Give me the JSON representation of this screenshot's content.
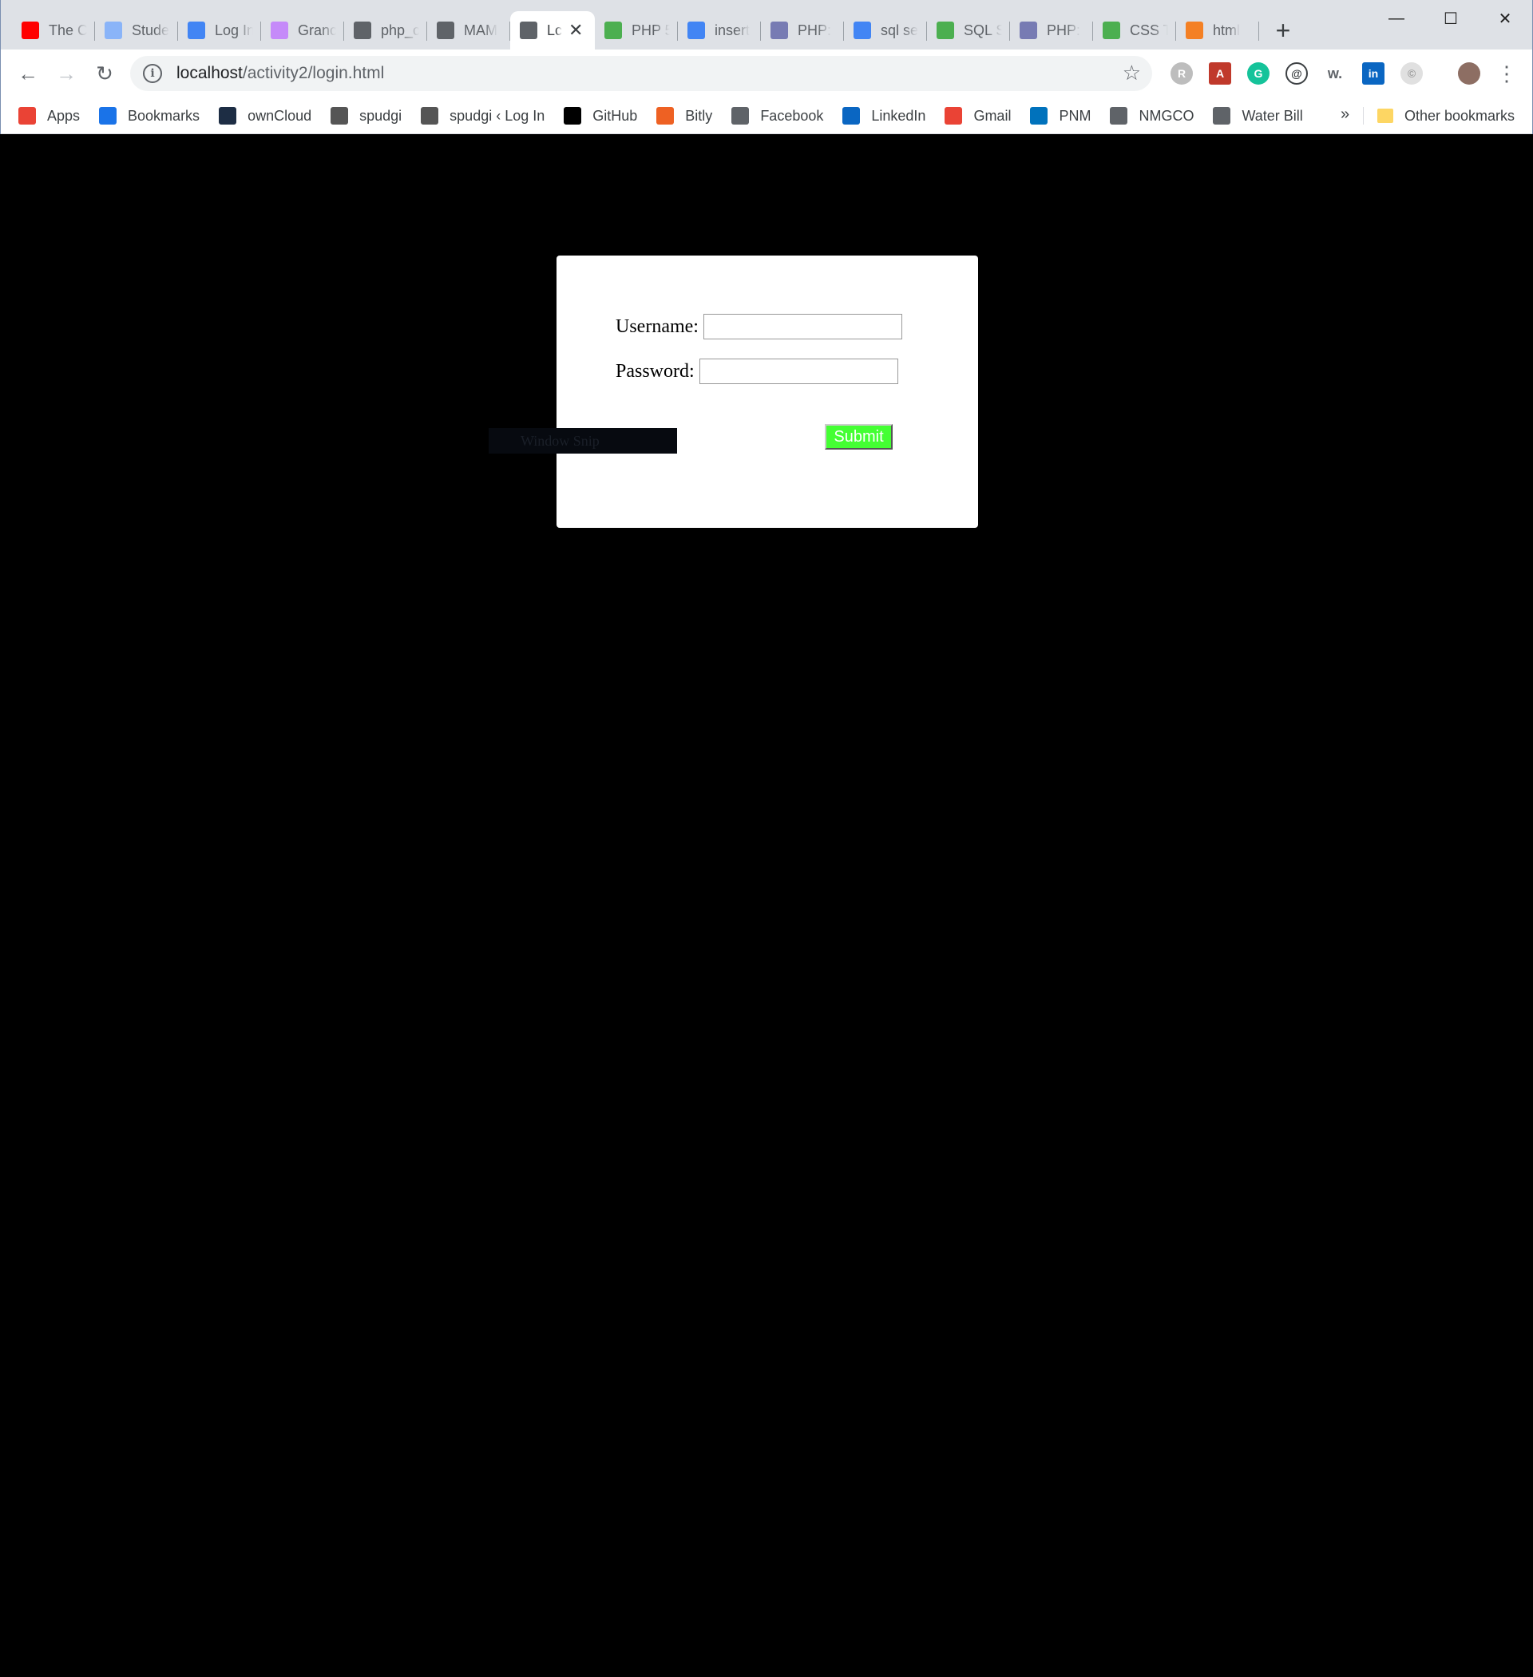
{
  "browser": {
    "tabs": [
      {
        "label": "The C",
        "icon": "youtube-icon",
        "color": "#ff0000"
      },
      {
        "label": "Stude",
        "icon": "page-icon",
        "color": "#8ab4f8"
      },
      {
        "label": "Log In",
        "icon": "globe-icon",
        "color": "#4285f4"
      },
      {
        "label": "Granc",
        "icon": "grid-icon",
        "color": "#c58af9"
      },
      {
        "label": "php_c",
        "icon": "file-icon",
        "color": "#5f6368"
      },
      {
        "label": "MAM",
        "icon": "file-icon",
        "color": "#5f6368"
      },
      {
        "label": "Lc",
        "icon": "file-icon",
        "color": "#5f6368",
        "active": true
      },
      {
        "label": "PHP 5",
        "icon": "w3schools-icon",
        "color": "#4caf50"
      },
      {
        "label": "insert",
        "icon": "google-icon",
        "color": "#4285f4"
      },
      {
        "label": "PHP: ",
        "icon": "php-icon",
        "color": "#777bb3"
      },
      {
        "label": "sql se",
        "icon": "google-icon",
        "color": "#4285f4"
      },
      {
        "label": "SQL S",
        "icon": "w3schools-icon",
        "color": "#4caf50"
      },
      {
        "label": "PHP: ",
        "icon": "php-icon",
        "color": "#777bb3"
      },
      {
        "label": "CSS T",
        "icon": "w3schools-icon",
        "color": "#4caf50"
      },
      {
        "label": "html",
        "icon": "stackoverflow-icon",
        "color": "#f48024"
      }
    ],
    "new_tab": "+",
    "window": {
      "minimize": "—",
      "maximize": "☐",
      "close": "✕"
    },
    "url": {
      "host": "localhost",
      "path": "/activity2/login.html"
    },
    "bookmarks": [
      {
        "label": "Apps",
        "icon": "apps-grid-icon",
        "color": "#ea4335"
      },
      {
        "label": "Bookmarks",
        "icon": "star-icon",
        "color": "#1a73e8"
      },
      {
        "label": "ownCloud",
        "icon": "owncloud-icon",
        "color": "#1d2d44"
      },
      {
        "label": "spudgi",
        "icon": "spudgi-icon",
        "color": "#555555"
      },
      {
        "label": "spudgi ‹ Log In",
        "icon": "spudgi-icon",
        "color": "#555555"
      },
      {
        "label": "GitHub",
        "icon": "github-icon",
        "color": "#000000"
      },
      {
        "label": "Bitly",
        "icon": "bitly-icon",
        "color": "#ee6123"
      },
      {
        "label": "Facebook",
        "icon": "file-icon",
        "color": "#5f6368"
      },
      {
        "label": "LinkedIn",
        "icon": "linkedin-icon",
        "color": "#0a66c2"
      },
      {
        "label": "Gmail",
        "icon": "gmail-icon",
        "color": "#ea4335"
      },
      {
        "label": "PNM",
        "icon": "pnm-icon",
        "color": "#0072bc"
      },
      {
        "label": "NMGCO",
        "icon": "doc-icon",
        "color": "#5f6368"
      },
      {
        "label": "Water Bill",
        "icon": "file-icon",
        "color": "#5f6368"
      }
    ],
    "more_bookmarks": "»",
    "other_bookmarks": "Other bookmarks"
  },
  "login": {
    "username_label": "Username:",
    "username_value": "",
    "password_label": "Password:",
    "password_value": "",
    "submit_label": "Submit",
    "submit_color": "#44ff33"
  },
  "overlay": {
    "snip_label": "Window Snip"
  }
}
